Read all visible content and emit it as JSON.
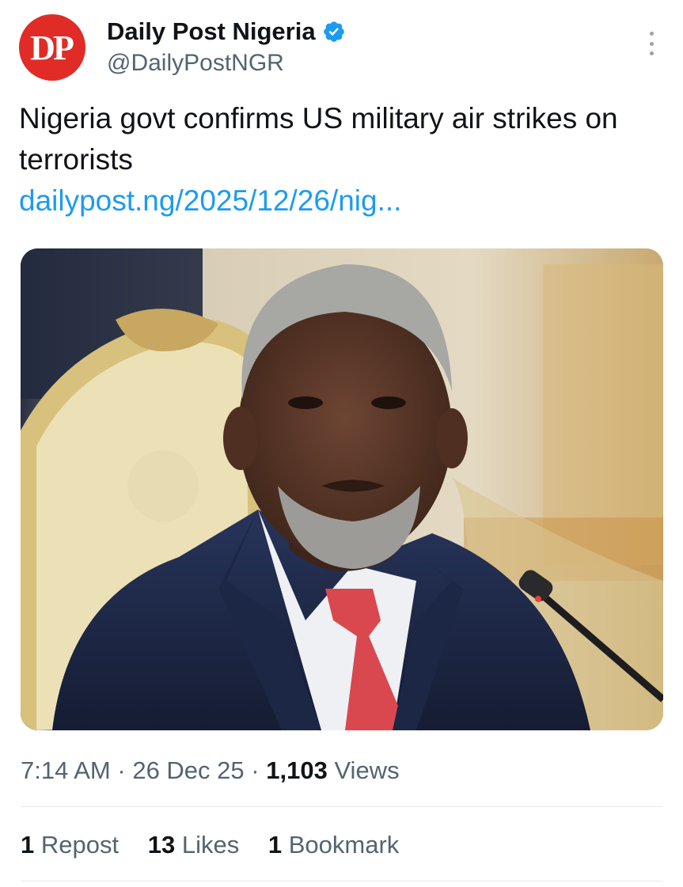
{
  "account": {
    "avatar_text": "DP",
    "display_name": "Daily Post Nigeria",
    "handle": "@DailyPostNGR",
    "verified": true
  },
  "tweet": {
    "text": "Nigeria govt confirms US military air strikes on terrorists",
    "link": "dailypost.ng/2025/12/26/nig...",
    "image_alt": "Portrait of a grey-haired man in a navy suit and red patterned tie seated in an ornate gold chair beside a microphone"
  },
  "meta": {
    "time": "7:14 AM",
    "date": "26 Dec 25",
    "views_count": "1,103",
    "views_label": "Views",
    "separator": "·"
  },
  "stats": {
    "reposts_count": "1",
    "reposts_label": "Repost",
    "likes_count": "13",
    "likes_label": "Likes",
    "bookmarks_count": "1",
    "bookmarks_label": "Bookmark"
  },
  "colors": {
    "avatar_bg": "#e02b27",
    "verified_blue": "#1d9bf0",
    "link": "#1d9bf0",
    "secondary_text": "#536471"
  },
  "icons": [
    "verified-badge-icon",
    "more-options-icon"
  ]
}
